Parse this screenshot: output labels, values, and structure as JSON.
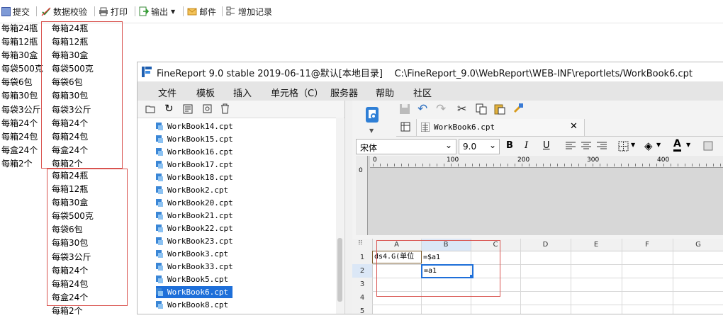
{
  "toolbar": {
    "submit": "提交",
    "validate": "数据校验",
    "print": "打印",
    "export": "输出",
    "email": "邮件",
    "add_record": "增加记录"
  },
  "report": {
    "col1": [
      "每箱24瓶",
      "每箱12瓶",
      "每箱30盒",
      "每袋500克",
      "每袋6包",
      "每箱30包",
      "每袋3公斤",
      "每箱24个",
      "每箱24包",
      "每盒24个",
      "每箱2个"
    ],
    "col2": [
      "每箱24瓶",
      "每箱12瓶",
      "每箱30盒",
      "每袋500克",
      "每袋6包",
      "每箱30包",
      "每袋3公斤",
      "每箱24个",
      "每箱24包",
      "每盒24个",
      "每箱2个"
    ],
    "col3": [
      "每箱24瓶",
      "每箱12瓶",
      "每箱30盒",
      "每袋500克",
      "每袋6包",
      "每箱30包",
      "每袋3公斤",
      "每箱24个",
      "每箱24包",
      "每盒24个",
      "每箱2个"
    ]
  },
  "window": {
    "title": "FineReport 9.0 stable 2019-06-11@默认[本地目录]    C:\\FineReport_9.0\\WebReport\\WEB-INF\\reportlets/WorkBook6.cpt",
    "menu": [
      "文件",
      "模板",
      "插入",
      "单元格（C）",
      "服务器",
      "帮助",
      "社区"
    ],
    "files": [
      "WorkBook14.cpt",
      "WorkBook15.cpt",
      "WorkBook16.cpt",
      "WorkBook17.cpt",
      "WorkBook18.cpt",
      "WorkBook2.cpt",
      "WorkBook20.cpt",
      "WorkBook21.cpt",
      "WorkBook22.cpt",
      "WorkBook23.cpt",
      "WorkBook3.cpt",
      "WorkBook33.cpt",
      "WorkBook5.cpt",
      "WorkBook6.cpt",
      "WorkBook8.cpt"
    ],
    "selected_file": "WorkBook6.cpt",
    "tab_label": "WorkBook6.cpt",
    "font_name": "宋体",
    "font_size": "9.0",
    "ruler": [
      "0",
      "100",
      "200",
      "300",
      "400"
    ],
    "columns": [
      "A",
      "B",
      "C",
      "D",
      "E",
      "F",
      "G"
    ],
    "rows": [
      "1",
      "2",
      "3",
      "4",
      "5"
    ],
    "cell_a1": "ds4.G(单位",
    "cell_b1": "=$a1",
    "cell_b2": "=a1"
  },
  "colors": {
    "accent": "#1e6fd9",
    "red": "#d9534f",
    "selected": "#1e6fd9"
  }
}
